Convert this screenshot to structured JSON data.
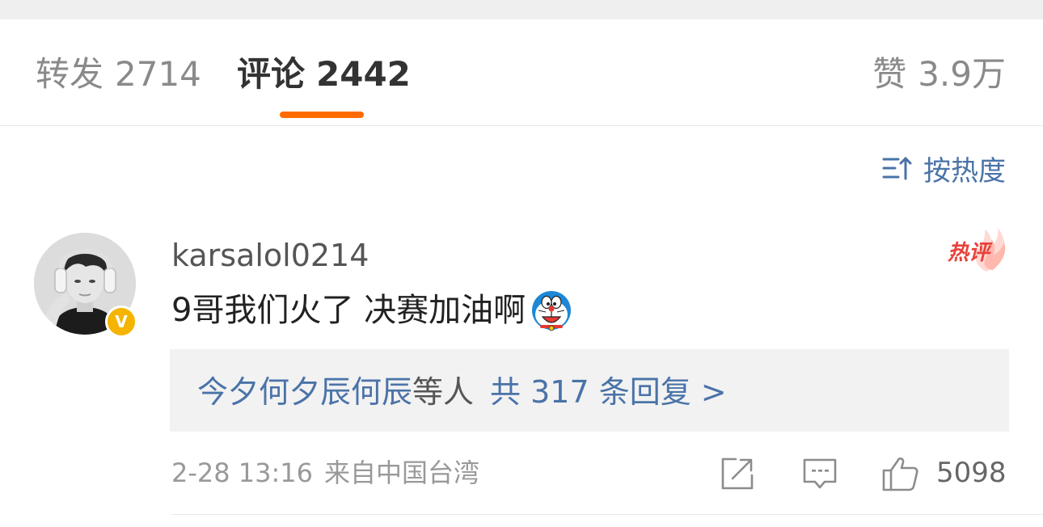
{
  "tabs": {
    "repost": {
      "label": "转发",
      "count": "2714"
    },
    "comments": {
      "label": "评论",
      "count": "2442"
    },
    "likes": {
      "label": "赞",
      "count": "3.9万"
    },
    "active_color": "#ff6a00"
  },
  "sort": {
    "label": "按热度",
    "icon": "sort-icon"
  },
  "comment": {
    "username": "karsalol0214",
    "text": "9哥我们火了 决赛加油啊",
    "emoji": "doraemon-emoji",
    "badge": "热评",
    "verified_label": "V",
    "replies": {
      "names": "今夕何夕辰何辰",
      "suffix": "等人",
      "total": "共 317 条回复 >"
    },
    "time": "2-28 13:16",
    "location": "来自中国台湾",
    "likes": "5098"
  },
  "colors": {
    "link": "#4a73a8",
    "accent": "#ff6a00",
    "badge": "#e8413a",
    "verified": "#f5b400"
  }
}
